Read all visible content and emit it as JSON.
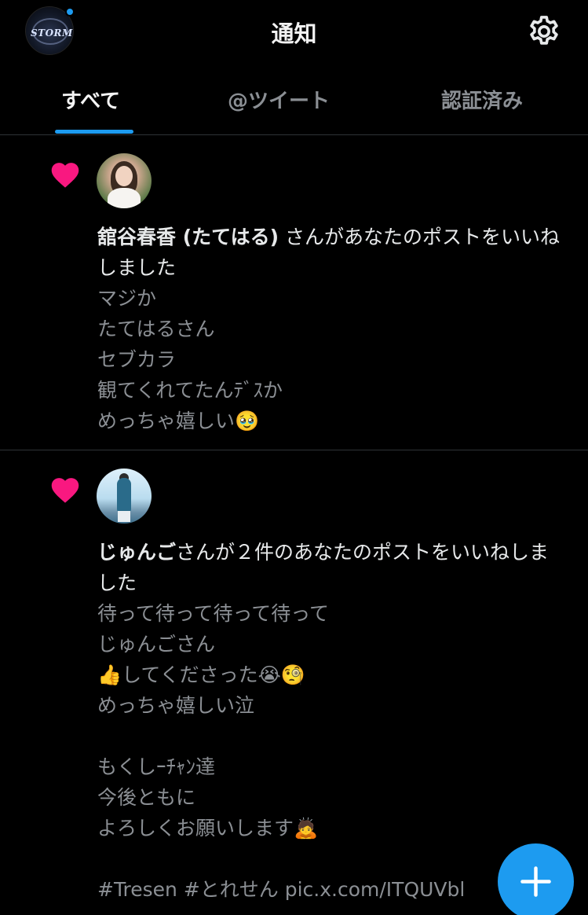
{
  "header": {
    "title": "通知",
    "avatar_logo_text": "STORM",
    "has_unread": true
  },
  "tabs": [
    {
      "label": "すべて",
      "active": true
    },
    {
      "label": "@ツイート",
      "active": false
    },
    {
      "label": "認証済み",
      "active": false
    }
  ],
  "notifications": [
    {
      "type": "like",
      "icon": "heart-icon",
      "user_name": "舘谷春香 (たてはる)",
      "action_text": " さんがあなたのポストをいいねしました",
      "post_text": "マジか\nたてはるさん\nセブカラ\n観てくれてたんﾃﾞｽか\nめっちゃ嬉しい🥹"
    },
    {
      "type": "like",
      "icon": "heart-icon",
      "user_name": "じゅんご",
      "action_text": "さんが２件のあなたのポストをいいねしました",
      "post_text": "待って待って待って待って\nじゅんごさん\n👍してくださった😭🧐\nめっちゃ嬉しい泣\n\nもくしｰﾁｬﾝ達\n今後ともに\nよろしくお願いします🙇\n\n#Tresen #とれせん pic.x.com/ITQUVbl"
    }
  ],
  "fab": {
    "icon": "plus-icon"
  },
  "colors": {
    "accent": "#1d9bf0",
    "heart": "#f91880",
    "background": "#000000",
    "secondary_text": "#8b8f94"
  }
}
